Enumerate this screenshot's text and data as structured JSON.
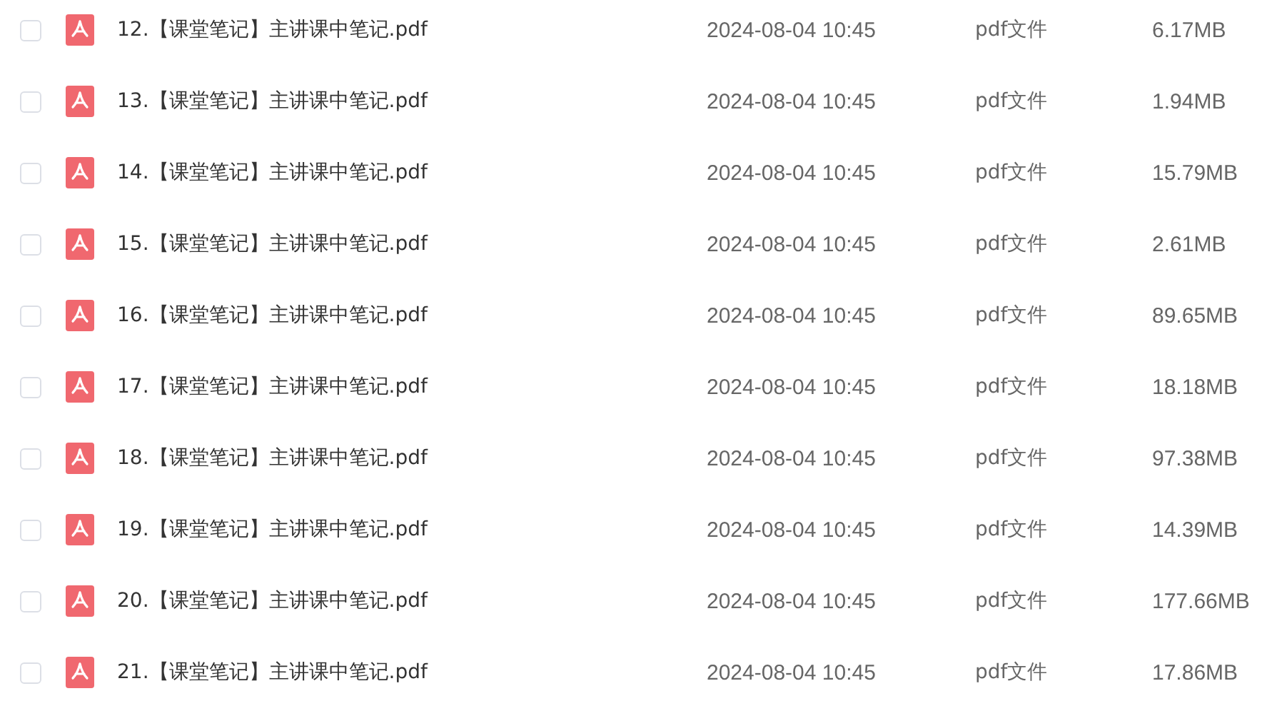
{
  "files": [
    {
      "name": "12.【课堂笔记】主讲课中笔记.pdf",
      "date": "2024-08-04 10:45",
      "type": "pdf文件",
      "size": "6.17MB",
      "checked": false
    },
    {
      "name": "13.【课堂笔记】主讲课中笔记.pdf",
      "date": "2024-08-04 10:45",
      "type": "pdf文件",
      "size": "1.94MB",
      "checked": false
    },
    {
      "name": "14.【课堂笔记】主讲课中笔记.pdf",
      "date": "2024-08-04 10:45",
      "type": "pdf文件",
      "size": "15.79MB",
      "checked": false
    },
    {
      "name": "15.【课堂笔记】主讲课中笔记.pdf",
      "date": "2024-08-04 10:45",
      "type": "pdf文件",
      "size": "2.61MB",
      "checked": false
    },
    {
      "name": "16.【课堂笔记】主讲课中笔记.pdf",
      "date": "2024-08-04 10:45",
      "type": "pdf文件",
      "size": "89.65MB",
      "checked": false
    },
    {
      "name": "17.【课堂笔记】主讲课中笔记.pdf",
      "date": "2024-08-04 10:45",
      "type": "pdf文件",
      "size": "18.18MB",
      "checked": false
    },
    {
      "name": "18.【课堂笔记】主讲课中笔记.pdf",
      "date": "2024-08-04 10:45",
      "type": "pdf文件",
      "size": "97.38MB",
      "checked": false
    },
    {
      "name": "19.【课堂笔记】主讲课中笔记.pdf",
      "date": "2024-08-04 10:45",
      "type": "pdf文件",
      "size": "14.39MB",
      "checked": false
    },
    {
      "name": "20.【课堂笔记】主讲课中笔记.pdf",
      "date": "2024-08-04 10:45",
      "type": "pdf文件",
      "size": "177.66MB",
      "checked": false
    },
    {
      "name": "21.【课堂笔记】主讲课中笔记.pdf",
      "date": "2024-08-04 10:45",
      "type": "pdf文件",
      "size": "17.86MB",
      "checked": false
    }
  ]
}
